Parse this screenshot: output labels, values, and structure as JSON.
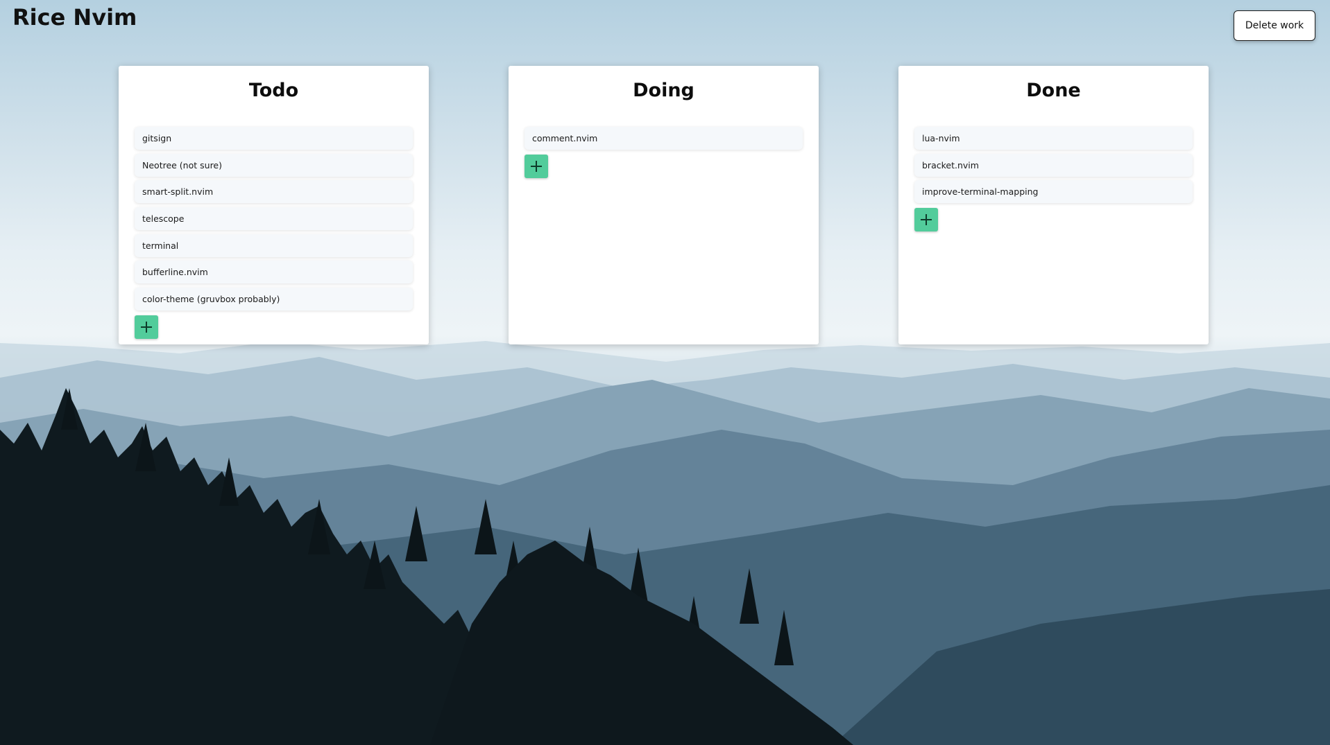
{
  "app": {
    "title": "Rice Nvim"
  },
  "header": {
    "delete_label": "Delete work"
  },
  "columns": [
    {
      "title": "Todo",
      "cards": [
        "gitsign",
        "Neotree (not sure)",
        "smart-split.nvim",
        "telescope",
        "terminal",
        "bufferline.nvim",
        "color-theme (gruvbox probably)"
      ]
    },
    {
      "title": "Doing",
      "cards": [
        "comment.nvim"
      ]
    },
    {
      "title": "Done",
      "cards": [
        "lua-nvim",
        "bracket.nvim",
        "improve-terminal-mapping"
      ]
    }
  ],
  "icons": {
    "add": "plus-icon"
  },
  "colors": {
    "add_button": "#52cc9b",
    "card_background": "#f5f8fb",
    "column_background": "#ffffff"
  }
}
